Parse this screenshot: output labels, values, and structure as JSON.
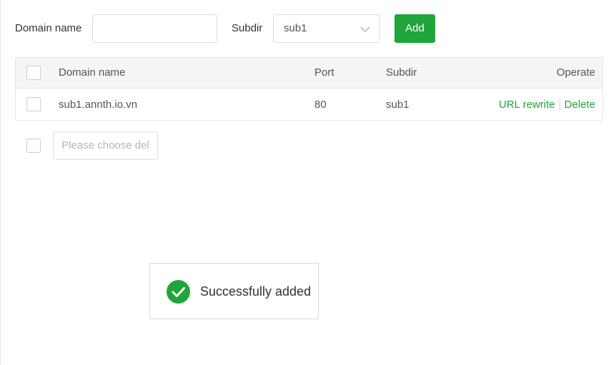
{
  "form": {
    "domain_label": "Domain name",
    "domain_value": "",
    "subdir_label": "Subdir",
    "subdir_value": "sub1",
    "add_label": "Add"
  },
  "table": {
    "headers": {
      "domain": "Domain name",
      "port": "Port",
      "subdir": "Subdir",
      "operate": "Operate"
    },
    "rows": [
      {
        "domain": "sub1.annth.io.vn",
        "port": "80",
        "subdir": "sub1",
        "actions": {
          "rewrite": "URL rewrite",
          "delete": "Delete"
        }
      }
    ]
  },
  "batch": {
    "delete_placeholder": "Please choose del"
  },
  "toast": {
    "message": "Successfully added",
    "icon": "check-circle-icon"
  },
  "colors": {
    "accent": "#20a53a",
    "border": "#dcdcdc",
    "header_bg": "#f5f5f5"
  }
}
